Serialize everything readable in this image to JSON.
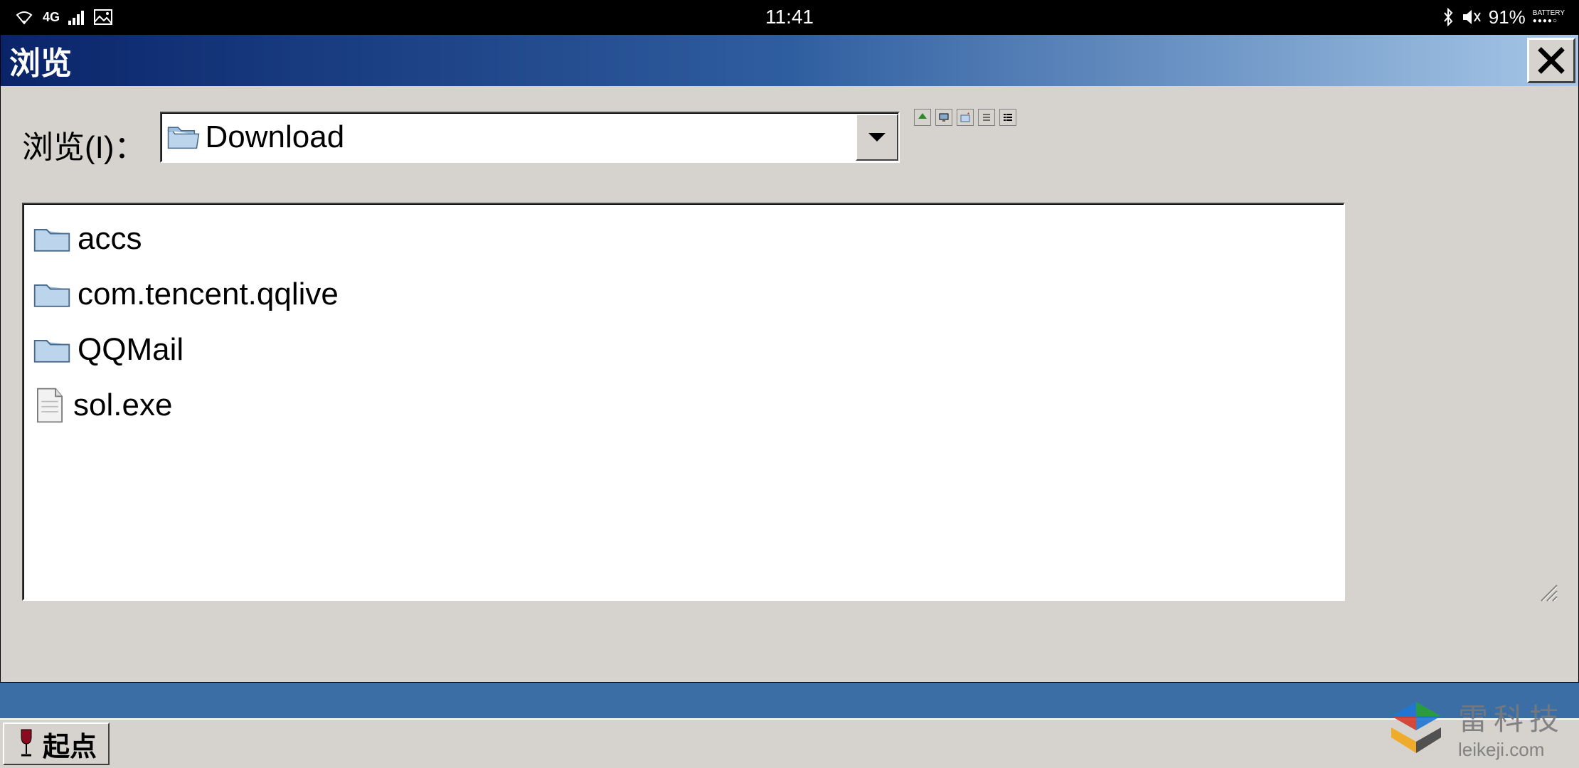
{
  "status": {
    "network": "4G",
    "time": "11:41",
    "battery_pct": "91%",
    "battery_label": "BATTERY"
  },
  "dialog": {
    "title": "浏览",
    "look_in_label": "浏览(I)：",
    "current_dir": "Download",
    "items": [
      {
        "name": "accs",
        "type": "folder"
      },
      {
        "name": "com.tencent.qqlive",
        "type": "folder"
      },
      {
        "name": "QQMail",
        "type": "folder"
      },
      {
        "name": "sol.exe",
        "type": "file"
      }
    ]
  },
  "taskbar": {
    "start_label": "起点"
  },
  "watermark": {
    "cn": "雷科技",
    "en": "leikeji.com"
  }
}
